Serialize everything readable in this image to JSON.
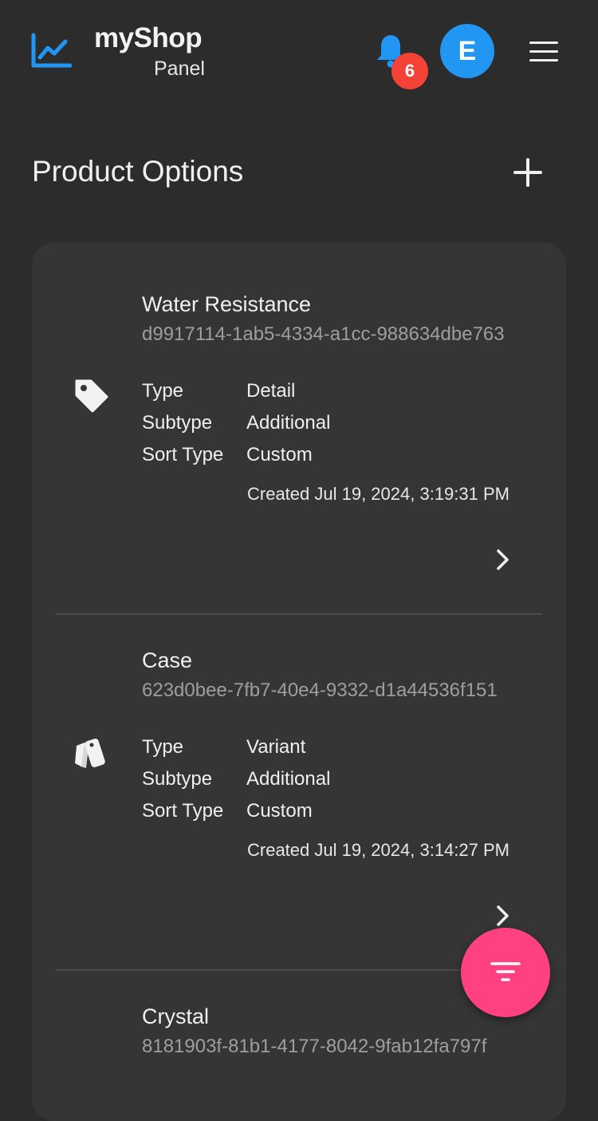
{
  "header": {
    "logo_icon": "trending-chart-icon",
    "brand_title": "myShop",
    "brand_subtitle": "Panel",
    "notifications_count": "6",
    "avatar_letter": "E",
    "accent_color": "#2196f3",
    "badge_color": "#f44336"
  },
  "page": {
    "title": "Product Options",
    "add_icon": "plus-icon"
  },
  "items": [
    {
      "name": "Water Resistance",
      "id": "d9917114-1ab5-4334-a1cc-988634dbe763",
      "icon": "tag-icon",
      "type_label": "Type",
      "type_value": "Detail",
      "subtype_label": "Subtype",
      "subtype_value": "Additional",
      "sort_label": "Sort Type",
      "sort_value": "Custom",
      "created": "Created Jul 19, 2024, 3:19:31 PM"
    },
    {
      "name": "Case",
      "id": "623d0bee-7fb7-40e4-9332-d1a44536f151",
      "icon": "swatches-icon",
      "type_label": "Type",
      "type_value": "Variant",
      "subtype_label": "Subtype",
      "subtype_value": "Additional",
      "sort_label": "Sort Type",
      "sort_value": "Custom",
      "created": "Created Jul 19, 2024, 3:14:27 PM"
    },
    {
      "name": "Crystal",
      "id": "8181903f-81b1-4177-8042-9fab12fa797f"
    }
  ],
  "fab": {
    "icon": "filter-icon",
    "color": "#ff4081"
  }
}
